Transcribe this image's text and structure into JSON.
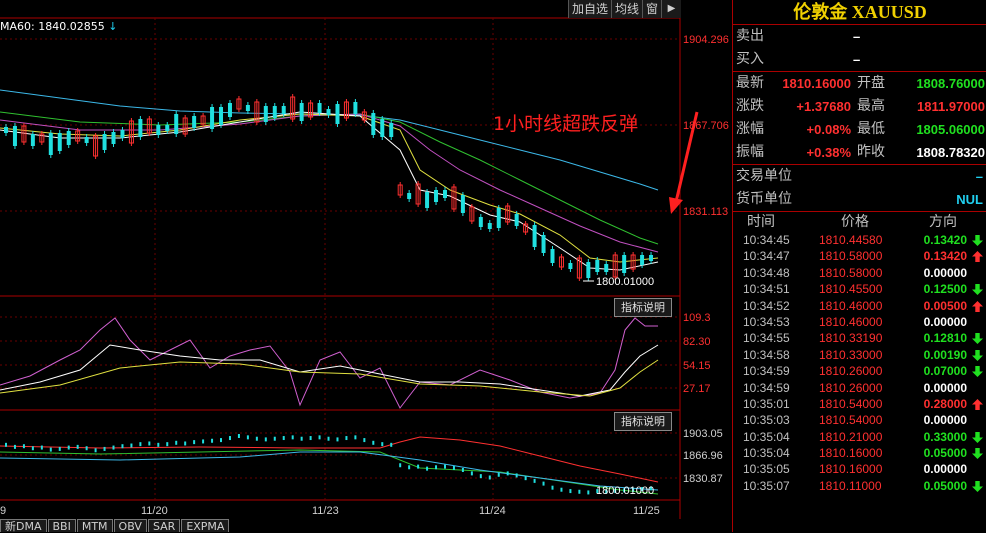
{
  "toolbar": {
    "add_watch": "加自选",
    "ma_line": "均线",
    "window": "窗",
    "expand": "▶"
  },
  "main_chart": {
    "ma_label": "MA60: 1840.02855",
    "annotation": "1小时线超跌反弹",
    "price_axis": [
      "1904.296",
      "1867.706",
      "1831.113"
    ],
    "low_label": "1800.01000"
  },
  "indicator1": {
    "button": "指标说明",
    "axis": [
      "109.3",
      "82.30",
      "54.15",
      "27.17"
    ]
  },
  "indicator2": {
    "button": "指标说明",
    "axis": [
      "1903.05",
      "1866.96",
      "1830.87"
    ],
    "low_label": "1800.01000"
  },
  "date_axis": [
    "11/20",
    "11/23",
    "11/24",
    "11/25"
  ],
  "left_edge_label": "9",
  "bottom_tabs": [
    "新DMA",
    "BBI",
    "MTM",
    "OBV",
    "SAR",
    "EXPMA"
  ],
  "quote": {
    "title": "伦敦金 XAUUSD",
    "sell_label": "卖出",
    "sell_value": "–",
    "buy_label": "买入",
    "buy_value": "–",
    "rows": [
      {
        "l1": "最新",
        "v1": "1810.16000",
        "c1": "red",
        "l2": "开盘",
        "v2": "1808.76000",
        "c2": "green"
      },
      {
        "l1": "涨跌",
        "v1": "+1.37680",
        "c1": "red",
        "l2": "最高",
        "v2": "1811.97000",
        "c2": "red"
      },
      {
        "l1": "涨幅",
        "v1": "+0.08%",
        "c1": "red",
        "l2": "最低",
        "v2": "1805.06000",
        "c2": "green"
      },
      {
        "l1": "振幅",
        "v1": "+0.38%",
        "c1": "red",
        "l2": "昨收",
        "v2": "1808.78320",
        "c2": "white"
      }
    ],
    "unit_label": "交易单位",
    "unit_value": "–",
    "currency_label": "货币单位",
    "currency_value": "NUL"
  },
  "ticks": {
    "headers": [
      "时间",
      "价格",
      "方向"
    ],
    "rows": [
      {
        "time": "10:34:45",
        "price": "1810.44580",
        "vol": "0.13420",
        "dir": "down"
      },
      {
        "time": "10:34:47",
        "price": "1810.58000",
        "vol": "0.13420",
        "dir": "up"
      },
      {
        "time": "10:34:48",
        "price": "1810.58000",
        "vol": "0.00000",
        "dir": "flat"
      },
      {
        "time": "10:34:51",
        "price": "1810.45500",
        "vol": "0.12500",
        "dir": "down"
      },
      {
        "time": "10:34:52",
        "price": "1810.46000",
        "vol": "0.00500",
        "dir": "up"
      },
      {
        "time": "10:34:53",
        "price": "1810.46000",
        "vol": "0.00000",
        "dir": "flat"
      },
      {
        "time": "10:34:55",
        "price": "1810.33190",
        "vol": "0.12810",
        "dir": "down"
      },
      {
        "time": "10:34:58",
        "price": "1810.33000",
        "vol": "0.00190",
        "dir": "down"
      },
      {
        "time": "10:34:59",
        "price": "1810.26000",
        "vol": "0.07000",
        "dir": "down"
      },
      {
        "time": "10:34:59",
        "price": "1810.26000",
        "vol": "0.00000",
        "dir": "flat"
      },
      {
        "time": "10:35:01",
        "price": "1810.54000",
        "vol": "0.28000",
        "dir": "up"
      },
      {
        "time": "10:35:03",
        "price": "1810.54000",
        "vol": "0.00000",
        "dir": "flat"
      },
      {
        "time": "10:35:04",
        "price": "1810.21000",
        "vol": "0.33000",
        "dir": "down"
      },
      {
        "time": "10:35:04",
        "price": "1810.16000",
        "vol": "0.05000",
        "dir": "down"
      },
      {
        "time": "10:35:05",
        "price": "1810.16000",
        "vol": "0.00000",
        "dir": "flat"
      },
      {
        "time": "10:35:07",
        "price": "1810.11000",
        "vol": "0.05000",
        "dir": "down"
      }
    ]
  },
  "colors": {
    "up": "#ff3030",
    "down": "#20e020",
    "flat": "#ffffff",
    "frame": "#aa0000",
    "title": "#f0d000"
  }
}
